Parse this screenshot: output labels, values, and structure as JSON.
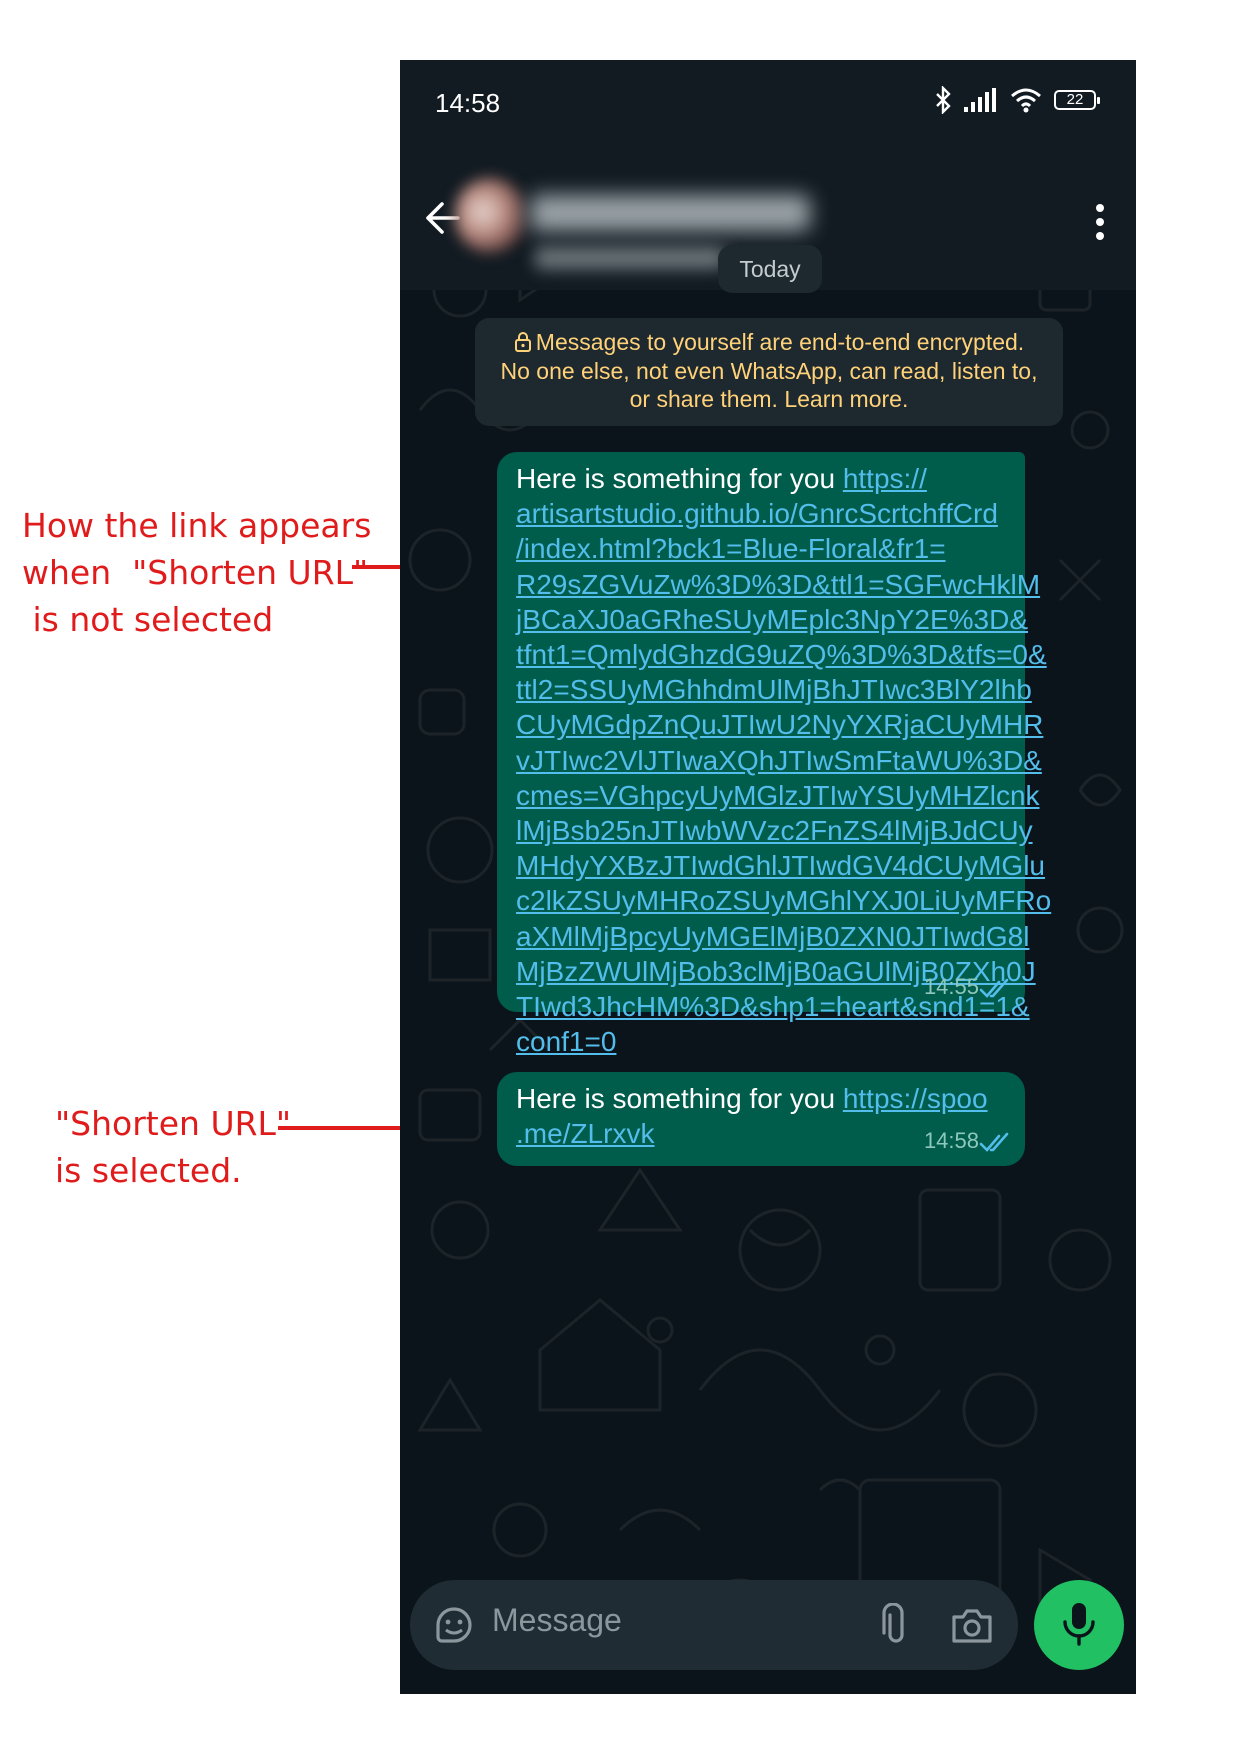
{
  "annotations": {
    "not_shortened": "How the link appears\nwhen  \"Shorten URL\"\n is not selected",
    "shortened": "\"Shorten URL\"\nis selected."
  },
  "status_bar": {
    "time": "14:58",
    "battery": "22",
    "icons": [
      "bluetooth-icon",
      "signal-icon",
      "wifi-icon",
      "battery-icon"
    ]
  },
  "header": {
    "contact_name": "",
    "contact_subtitle": "",
    "icons": [
      "back-arrow-icon",
      "avatar",
      "more-vertical-icon"
    ]
  },
  "chat": {
    "date_label": "Today",
    "encryption_notice": {
      "line1": "Messages to yourself are end-to-end encrypted.",
      "line2": "No one else, not even WhatsApp, can read, listen to,",
      "line3_prefix": "or share them. ",
      "learn_more": "Learn more."
    },
    "messages": [
      {
        "text": "Here is something for you ",
        "link_lines": [
          "https://",
          "artisartstudio.github.io/GnrcScrtchffCrd",
          "/index.html?bck1=Blue-Floral&fr1=",
          "R29sZGVuZw%3D%3D&ttl1=SGFwcHklM",
          "jBCaXJ0aGRheSUyMEplc3NpY2E%3D&",
          "tfnt1=QmlydGhzdG9uZQ%3D%3D&tfs=0&",
          "ttl2=SSUyMGhhdmUlMjBhJTIwc3BlY2lhb",
          "CUyMGdpZnQuJTIwU2NyYXRjaCUyMHR",
          "vJTIwc2VlJTIwaXQhJTIwSmFtaWU%3D&",
          "cmes=VGhpcyUyMGlzJTIwYSUyMHZlcnk",
          "lMjBsb25nJTIwbWVzc2FnZS4lMjBJdCUy",
          "MHdyYXBzJTIwdGhlJTIwdGV4dCUyMGlu",
          "c2lkZSUyMHRoZSUyMGhlYXJ0LiUyMFRo",
          "aXMlMjBpcyUyMGElMjB0ZXN0JTIwdG8l",
          "MjBzZWUlMjBob3clMjB0aGUlMjB0ZXh0J",
          "TIwd3JhcHM%3D&shp1=heart&snd1=1&",
          "conf1=0"
        ],
        "time": "14:55",
        "status": "read"
      },
      {
        "text": "Here is something for you ",
        "link_lines": [
          "https://spoo",
          ".me/ZLrxvk"
        ],
        "time": "14:58",
        "status": "read"
      }
    ]
  },
  "composer": {
    "placeholder": "Message",
    "icons": [
      "sticker-icon",
      "attach-icon",
      "camera-icon",
      "mic-icon"
    ]
  },
  "colors": {
    "annotation": "#e01b1b",
    "header_bg": "#121b22",
    "chat_bg": "#0b141a",
    "outgoing_bubble": "#005c4b",
    "link": "#53bdeb",
    "notice_text": "#ffd279",
    "mic_button": "#21c063",
    "read_ticks": "#53bdeb"
  }
}
